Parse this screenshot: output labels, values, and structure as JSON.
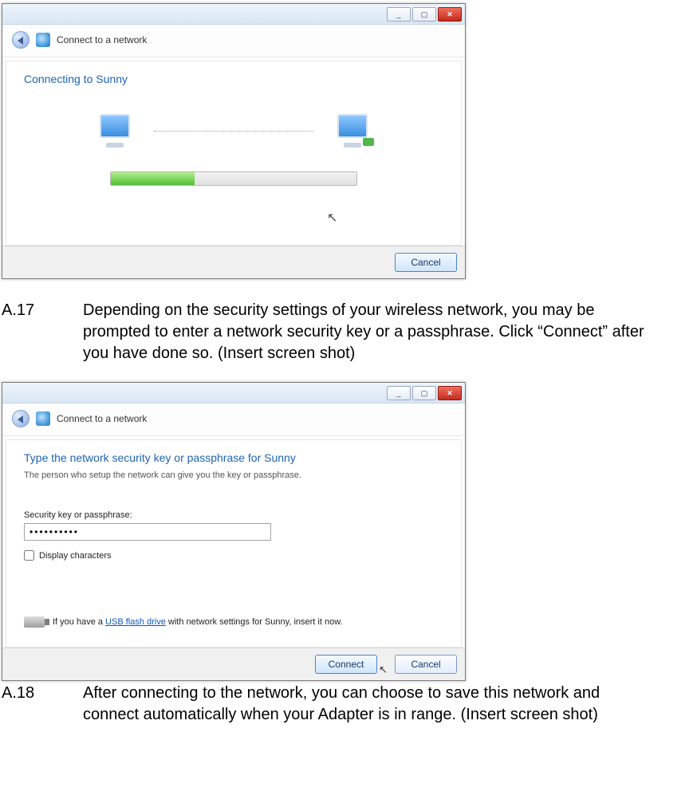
{
  "dialog1": {
    "header_title": "Connect to a network",
    "heading": "Connecting to Sunny",
    "cancel_label": "Cancel"
  },
  "dialog2": {
    "header_title": "Connect to a network",
    "heading": "Type the network security key or passphrase for Sunny",
    "subtext": "The person who setup the network can give you the key or passphrase.",
    "field_label": "Security key or passphrase:",
    "password_value": "••••••••••",
    "display_chars_label": "Display characters",
    "usb_hint_pre": "If you have a ",
    "usb_hint_link": "USB flash drive",
    "usb_hint_post": " with network settings for Sunny, insert it now.",
    "connect_label": "Connect",
    "cancel_label": "Cancel"
  },
  "doc": {
    "a17_num": "A.17",
    "a17_text": "Depending on the security settings of your wireless network, you may be prompted to enter a network security key or a passphrase. Click “Connect” after you have done so.  (Insert screen shot)",
    "a18_num": "A.18",
    "a18_text": "After connecting to the network, you can choose to save this network and connect automatically when your Adapter is in range. (Insert screen shot)"
  }
}
